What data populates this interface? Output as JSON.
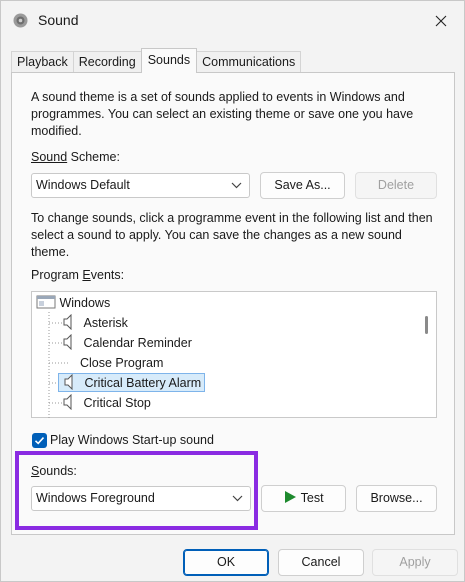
{
  "window": {
    "title": "Sound"
  },
  "tabs": [
    "Playback",
    "Recording",
    "Sounds",
    "Communications"
  ],
  "active_tab": "Sounds",
  "description": "A sound theme is a set of sounds applied to events in Windows and programmes. You can select an existing theme or save one you have modified.",
  "sound_scheme": {
    "label": "Sound Scheme:",
    "value": "Windows Default",
    "save_as": "Save As...",
    "delete": "Delete"
  },
  "instructions": "To change sounds, click a programme event in the following list and then select a sound to apply. You can save the changes as a new sound theme.",
  "program_events": {
    "label": "Program Events:",
    "root": "Windows",
    "items": [
      {
        "label": "Asterisk",
        "has_sound": true,
        "selected": false
      },
      {
        "label": "Calendar Reminder",
        "has_sound": true,
        "selected": false
      },
      {
        "label": "Close Program",
        "has_sound": false,
        "selected": false
      },
      {
        "label": "Critical Battery Alarm",
        "has_sound": true,
        "selected": true
      },
      {
        "label": "Critical Stop",
        "has_sound": true,
        "selected": false
      }
    ]
  },
  "startup": {
    "label": "Play Windows Start-up sound",
    "checked": true
  },
  "sounds": {
    "label": "Sounds:",
    "value": "Windows Foreground",
    "test": "Test",
    "browse": "Browse..."
  },
  "footer": {
    "ok": "OK",
    "cancel": "Cancel",
    "apply": "Apply"
  },
  "colors": {
    "accent": "#005fb8",
    "highlight_box": "#8a2be2",
    "play_icon": "#1e8a2e"
  }
}
